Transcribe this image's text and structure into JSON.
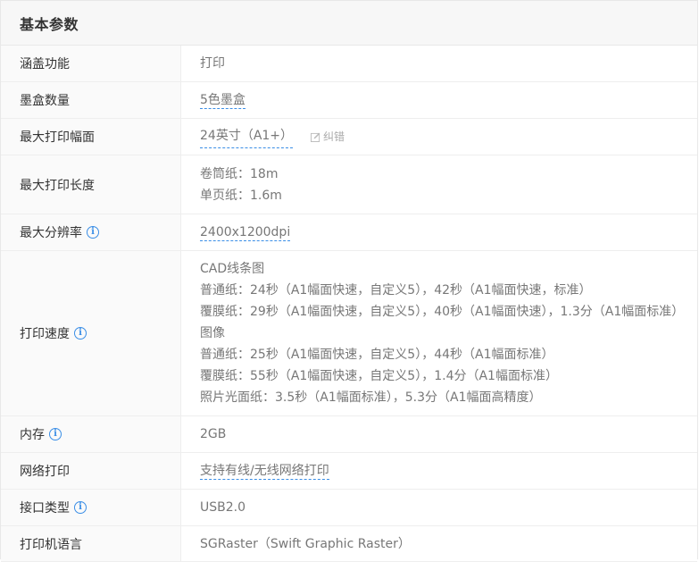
{
  "section": {
    "title": "基本参数"
  },
  "rows": [
    {
      "label": "涵盖功能",
      "value": "打印"
    },
    {
      "label": "墨盒数量",
      "value": "5色墨盒"
    },
    {
      "label": "最大打印幅面",
      "value": "24英寸（A1+）",
      "correction": "纠错"
    },
    {
      "label": "最大打印长度",
      "lines": [
        "卷筒纸：18m",
        "单页纸：1.6m"
      ]
    },
    {
      "label": "最大分辨率",
      "value": "2400x1200dpi"
    },
    {
      "label": "打印速度",
      "lines": [
        "CAD线条图",
        "普通纸：24秒（A1幅面快速，自定义5），42秒（A1幅面快速，标准）",
        "覆膜纸：29秒（A1幅面快速，自定义5），40秒（A1幅面快速），1.3分（A1幅面标准）",
        "图像",
        "普通纸：25秒（A1幅面快速，自定义5），44秒（A1幅面标准）",
        "覆膜纸：55秒（A1幅面快速，自定义5），1.4分（A1幅面标准）",
        "照片光面纸：3.5秒（A1幅面标准），5.3分（A1幅面高精度）"
      ]
    },
    {
      "label": "内存",
      "value": "2GB"
    },
    {
      "label": "网络打印",
      "value": "支持有线/无线网络打印"
    },
    {
      "label": "接口类型",
      "value": "USB2.0"
    },
    {
      "label": "打印机语言",
      "value": "SGRaster（Swift Graphic Raster）"
    }
  ],
  "icons": {
    "info": "info-icon",
    "edit": "edit-icon"
  },
  "colors": {
    "accent": "#3a8ee6",
    "label_bg": "#fafafa",
    "header_bg": "#f7f7f7"
  }
}
